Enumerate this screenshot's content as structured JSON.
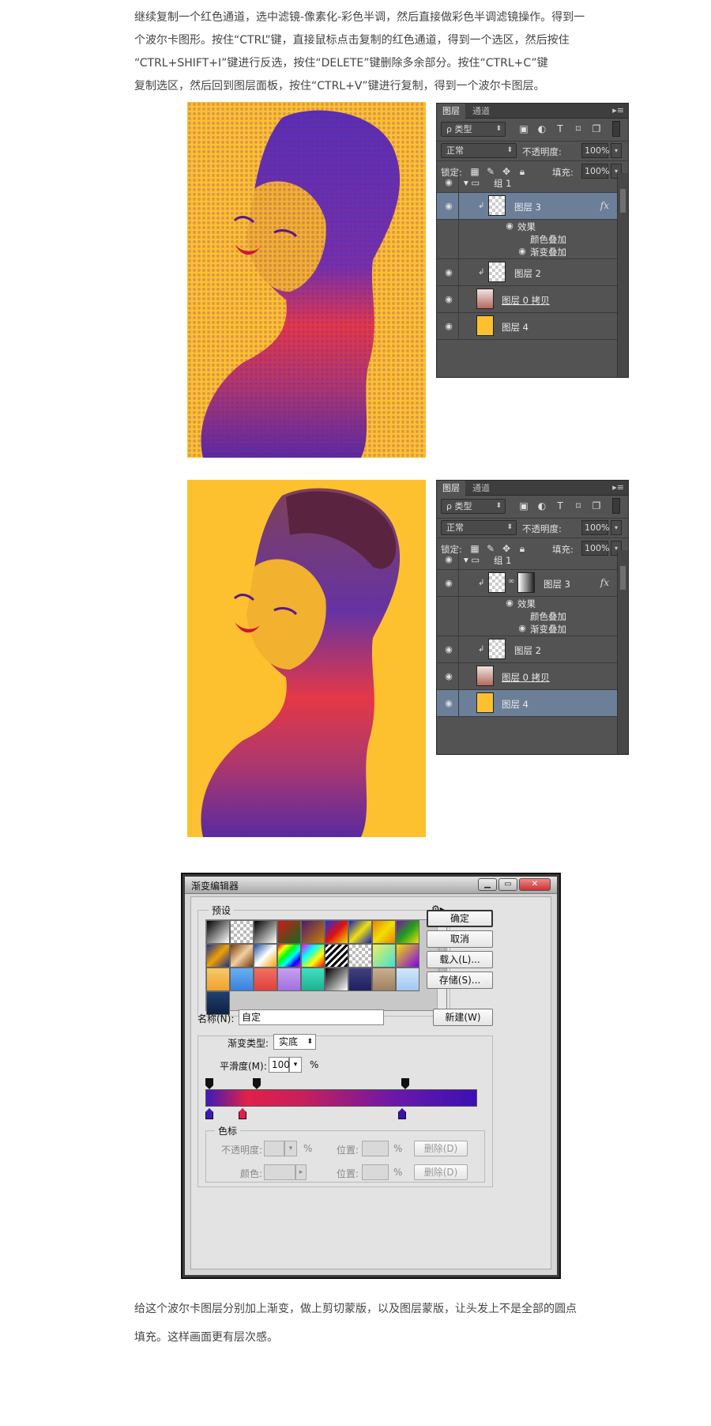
{
  "intro_text": {
    "lines": [
      "继续复制一个红色通道，选中滤镜-像素化-彩色半调，然后直接做彩色半调滤镜操作。得到一",
      "个波尔卡图形。按住“CTRL”键，直接鼠标点击复制的红色通道，得到一个选区，然后按住",
      "“CTRL+SHIFT+I”键进行反选，按住“DELETE”键删除多余部分。按住“CTRL+C”键",
      "复制选区，然后回到图层面板，按住“CTRL+V”键进行复制，得到一个波尔卡图层。"
    ]
  },
  "colors": {
    "art_background": "#fdc12f",
    "panel_bg": "#535353",
    "selected_row": "#6b7f99",
    "gradient": [
      "#3c1bb8",
      "#e0204a",
      "#3c10b4"
    ]
  },
  "panel1": {
    "tabs": [
      "图层",
      "通道"
    ],
    "filter_label": "ρ 类型",
    "blend_mode": "正常",
    "opacity_label": "不透明度:",
    "opacity_value": "100%",
    "lock_label": "锁定:",
    "fill_label": "填充:",
    "fill_value": "100%",
    "group_name": "组 1",
    "layer3_name": "图层 3",
    "effects_label": "效果",
    "effect_color_overlay": "颜色叠加",
    "effect_gradient_overlay": "渐变叠加",
    "layer2_name": "图层 2",
    "layer0copy_name": "图层 0 拷贝",
    "layer4_name": "图层 4",
    "fx_label": "fx"
  },
  "panel2": {
    "tabs": [
      "图层",
      "通道"
    ],
    "filter_label": "ρ 类型",
    "blend_mode": "正常",
    "opacity_label": "不透明度:",
    "opacity_value": "100%",
    "lock_label": "锁定:",
    "fill_label": "填充:",
    "fill_value": "100%",
    "group_name": "组 1",
    "layer3_name": "图层 3",
    "effects_label": "效果",
    "effect_color_overlay": "颜色叠加",
    "effect_gradient_overlay": "渐变叠加",
    "layer2_name": "图层 2",
    "layer0copy_name": "图层 0 拷贝",
    "layer4_name": "图层 4",
    "fx_label": "fx"
  },
  "gradient_editor": {
    "title": "渐变编辑器",
    "presets_label": "预设",
    "ok": "确定",
    "cancel": "取消",
    "load": "载入(L)...",
    "save": "存储(S)...",
    "name_label": "名称(N):",
    "name_value": "自定",
    "new_button": "新建(W)",
    "type_label": "渐变类型:",
    "type_value": "实底",
    "smooth_label": "平滑度(M):",
    "smooth_value": "100",
    "percent": "%",
    "stops_label": "色标",
    "opacity_label": "不透明度:",
    "location_label": "位置:",
    "delete_label": "删除(D)",
    "color_label": "颜色:"
  },
  "outro_text": {
    "lines": [
      "给这个波尔卡图层分别加上渐变，做上剪切蒙版，以及图层蒙版，让头发上不是全部的圆点",
      "填充。这样画面更有层次感。"
    ]
  }
}
